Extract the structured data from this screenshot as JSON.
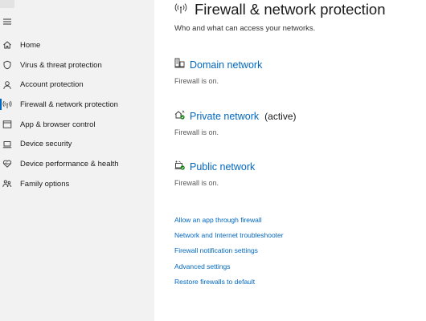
{
  "sidebar": {
    "items": [
      {
        "label": "Home",
        "icon": "home-icon"
      },
      {
        "label": "Virus & threat protection",
        "icon": "shield-icon"
      },
      {
        "label": "Account protection",
        "icon": "person-icon"
      },
      {
        "label": "Firewall & network protection",
        "icon": "wifi-antenna-icon",
        "selected": true
      },
      {
        "label": "App & browser control",
        "icon": "browser-window-icon"
      },
      {
        "label": "Device security",
        "icon": "laptop-icon"
      },
      {
        "label": "Device performance & health",
        "icon": "heart-icon"
      },
      {
        "label": "Family options",
        "icon": "family-icon"
      }
    ]
  },
  "main": {
    "title": "Firewall & network protection",
    "subtitle": "Who and what can access your networks.",
    "networks": [
      {
        "name": "Domain network",
        "active": "",
        "status": "Firewall is on.",
        "icon": "domain-network-icon"
      },
      {
        "name": "Private network",
        "active": "(active)",
        "status": "Firewall is on.",
        "icon": "private-network-icon"
      },
      {
        "name": "Public network",
        "active": "",
        "status": "Firewall is on.",
        "icon": "public-network-icon"
      }
    ],
    "links": [
      "Allow an app through firewall",
      "Network and Internet troubleshooter",
      "Firewall notification settings",
      "Advanced settings",
      "Restore firewalls to default"
    ]
  },
  "colors": {
    "accent": "#0067c0",
    "sidebar_bg": "#f2f2f2",
    "status_ok": "#107c10"
  }
}
